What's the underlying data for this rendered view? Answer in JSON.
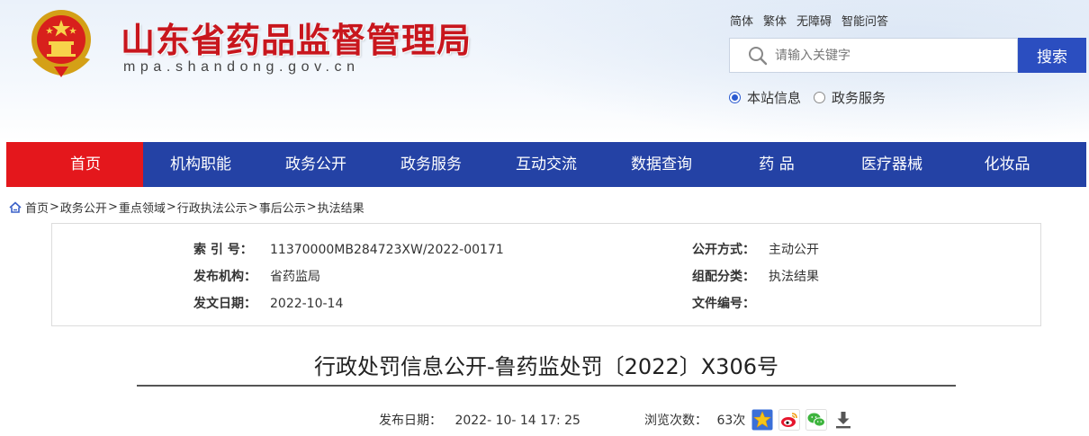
{
  "header": {
    "site_title": "山东省药品监督管理局",
    "site_domain": "mpa.shandong.gov.cn",
    "top_links": [
      "简体",
      "繁体",
      "无障碍",
      "智能问答"
    ],
    "search_placeholder": "请输入关键字",
    "search_button": "搜索",
    "search_scopes": [
      {
        "label": "本站信息",
        "checked": true
      },
      {
        "label": "政务服务",
        "checked": false
      }
    ]
  },
  "nav": {
    "items": [
      "首页",
      "机构职能",
      "政务公开",
      "政务服务",
      "互动交流",
      "数据查询",
      "药 品",
      "医疗器械",
      "化妆品"
    ],
    "active_index": 0
  },
  "breadcrumb": [
    "首页",
    "政务公开",
    "重点领域",
    "行政执法公示",
    "事后公示",
    "执法结果"
  ],
  "meta": {
    "index_no_label": "索 引 号：",
    "index_no": "11370000MB284723XW/2022-00171",
    "publish_org_label": "发布机构：",
    "publish_org": "省药监局",
    "issue_date_label": "发文日期：",
    "issue_date": "2022-10-14",
    "open_mode_label": "公开方式：",
    "open_mode": "主动公开",
    "category_label": "组配分类：",
    "category": "执法结果",
    "doc_no_label": "文件编号：",
    "doc_no": ""
  },
  "document": {
    "title": "行政处罚信息公开-鲁药监处罚〔2022〕X306号",
    "publish_label": "发布日期：",
    "publish_datetime": "2022- 10- 14 17: 25",
    "views_label": "浏览次数：",
    "views": "63次"
  },
  "colors": {
    "nav_bg": "#2442a5",
    "nav_active": "#e4171c",
    "title_red": "#c8161d",
    "search_btn": "#2b4ec0"
  },
  "icons": [
    "national-emblem-icon",
    "search-icon",
    "home-icon",
    "favorite-star-icon",
    "weibo-icon",
    "wechat-icon",
    "download-icon"
  ]
}
